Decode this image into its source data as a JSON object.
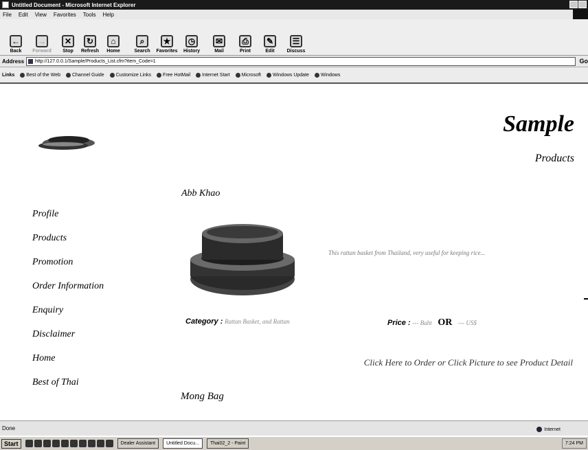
{
  "window": {
    "title": "Untitled Document - Microsoft Internet Explorer"
  },
  "menu": [
    "File",
    "Edit",
    "View",
    "Favorites",
    "Tools",
    "Help"
  ],
  "toolbar": [
    "Back",
    "Forward",
    "Stop",
    "Refresh",
    "Home",
    "Search",
    "Favorites",
    "History",
    "Mail",
    "Print",
    "Edit",
    "Discuss"
  ],
  "address": {
    "label": "Address",
    "url": "http://127.0.0.1/Sample/Products_List.cfm?item_Code=1",
    "go": "Go"
  },
  "links": {
    "label": "Links",
    "items": [
      "Best of the Web",
      "Channel Guide",
      "Customize Links",
      "Free HotMail",
      "Internet Start",
      "Microsoft",
      "Windows Update",
      "Windows"
    ]
  },
  "page": {
    "title": "Sample",
    "subtitle": "Products",
    "nav": [
      "Profile",
      "Products",
      "Promotion",
      "Order Information",
      "Enquiry",
      "Disclaimer",
      "Home",
      "Best of Thai"
    ],
    "product": {
      "name": "Abb Khao",
      "description": "This rattan basket from Thailand, very useful for keeping rice...",
      "category_label": "Category :",
      "category_value": "Rattan Basket, and Rattan",
      "price_label": "Price :",
      "price_value": "--- Baht",
      "or": "OR",
      "price_value2": "--- US$",
      "order_link": "Click Here to Order or Click Picture to see Product Detail"
    },
    "next_product": "Mong Bag"
  },
  "status": {
    "text": "Done",
    "zone": "Internet"
  },
  "taskbar": {
    "start": "Start",
    "tasks": [
      "Dealer Assistant",
      "Untitled Docu...",
      "Thai02_2 - Paint"
    ],
    "clock": "7:24 PM"
  },
  "colors": {
    "titlebar": "#1a1a1a",
    "chrome": "#e8e8e8",
    "text_muted": "#777777"
  }
}
